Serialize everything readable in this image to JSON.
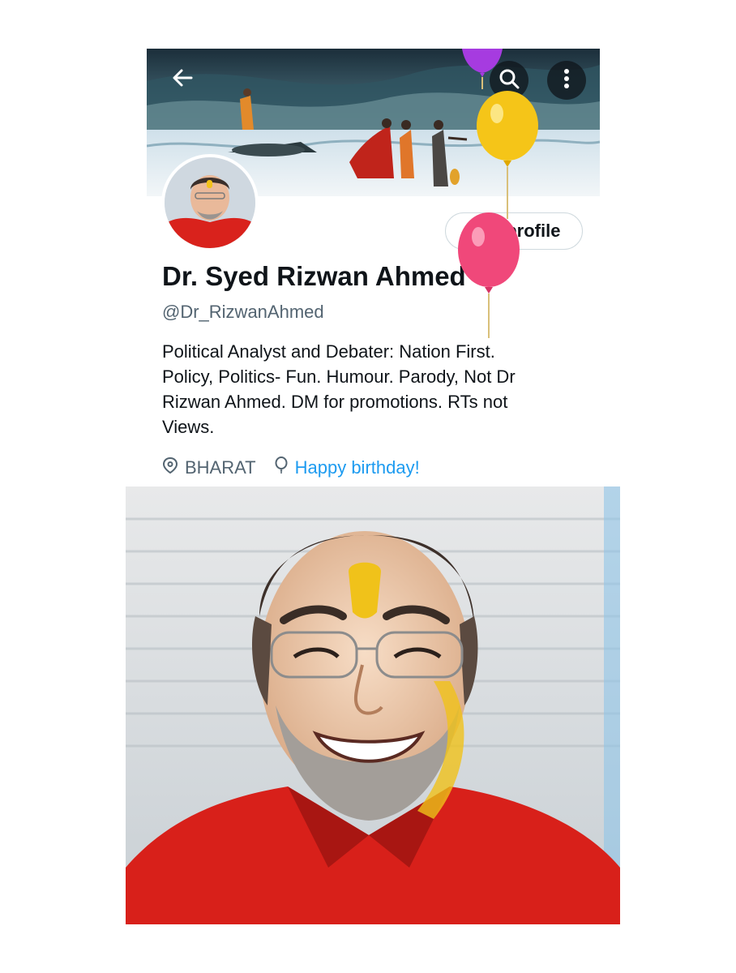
{
  "header": {
    "back_icon": "arrow-left-icon",
    "search_icon": "search-icon",
    "more_icon": "more-vertical-icon"
  },
  "profile": {
    "display_name": "Dr. Syed Rizwan Ahmed",
    "handle": "@Dr_RizwanAhmed",
    "bio_lines": [
      "Political Analyst and Debater: Nation First.",
      "Policy, Politics- Fun. Humour. Parody, Not Dr",
      "Rizwan Ahmed.  DM for promotions. RTs not",
      "Views."
    ],
    "location": "BHARAT",
    "birthday_text": "Happy birthday!",
    "edit_button_label": "Edit profile"
  },
  "colors": {
    "link_blue": "#1d9bf0",
    "secondary_text": "#536471",
    "primary_text": "#0f1419",
    "balloon_purple": "#a63be0",
    "balloon_yellow": "#f5c518",
    "balloon_pink": "#f0487a"
  }
}
